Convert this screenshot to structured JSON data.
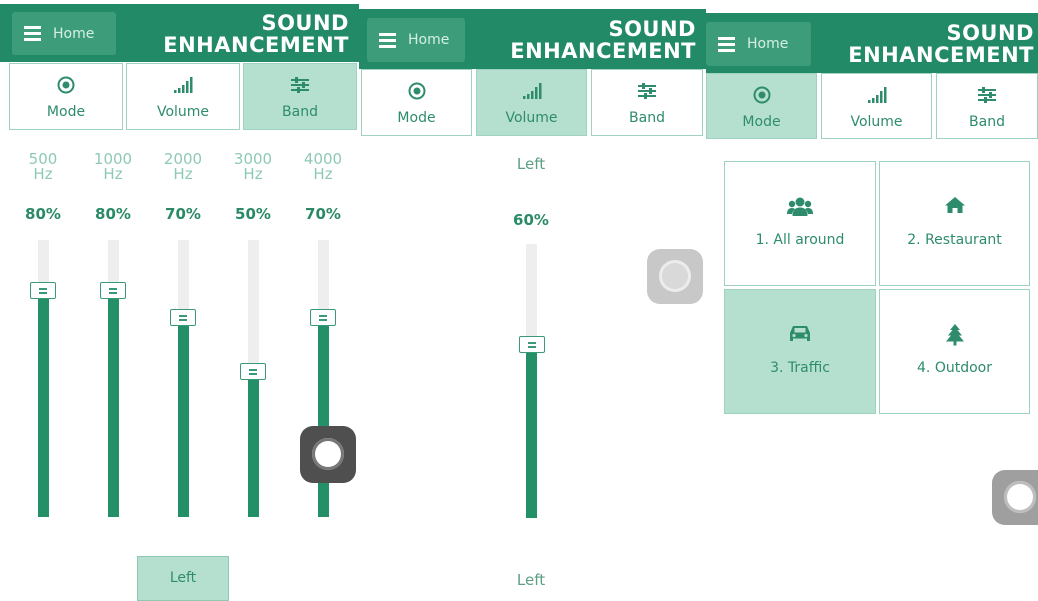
{
  "header": {
    "home_label": "Home",
    "title_line1": "SOUND",
    "title_line2": "ENHANCEMENT"
  },
  "tabs": {
    "mode": "Mode",
    "volume": "Volume",
    "band": "Band"
  },
  "band_screen": {
    "active_tab": "Band",
    "bands": [
      {
        "freq": "500",
        "unit": "Hz",
        "pct_label": "80%",
        "level": 0.8
      },
      {
        "freq": "1000",
        "unit": "Hz",
        "pct_label": "80%",
        "level": 0.8
      },
      {
        "freq": "2000",
        "unit": "Hz",
        "pct_label": "70%",
        "level": 0.7
      },
      {
        "freq": "3000",
        "unit": "Hz",
        "pct_label": "50%",
        "level": 0.5
      },
      {
        "freq": "4000",
        "unit": "Hz",
        "pct_label": "70%",
        "level": 0.7
      }
    ],
    "side_button": "Left"
  },
  "volume_screen": {
    "active_tab": "Volume",
    "side_top": "Left",
    "pct_label": "60%",
    "level": 0.6,
    "side_bottom": "Left"
  },
  "mode_screen": {
    "active_tab": "Mode",
    "modes": [
      {
        "label": "1. All around",
        "icon": "users-icon",
        "selected": false
      },
      {
        "label": "2. Restaurant",
        "icon": "home-icon",
        "selected": false
      },
      {
        "label": "3. Traffic",
        "icon": "car-icon",
        "selected": true
      },
      {
        "label": "4. Outdoor",
        "icon": "tree-icon",
        "selected": false
      }
    ]
  },
  "colors": {
    "header": "#228a66",
    "accent_fill": "#239068",
    "active_tab": "#b5e0cf",
    "border": "#9fd2bf"
  }
}
